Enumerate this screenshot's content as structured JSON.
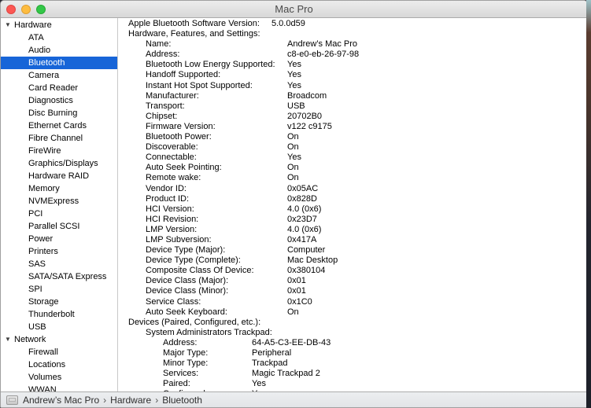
{
  "window": {
    "title": "Mac Pro"
  },
  "accent": {
    "selection_color": "#1765d8",
    "traffic_red": "#fc5753",
    "traffic_yellow": "#fdbc40",
    "traffic_green": "#33c748"
  },
  "sidebar": {
    "items": [
      {
        "type": "group",
        "label": "Hardware"
      },
      {
        "type": "item",
        "label": "ATA"
      },
      {
        "type": "item",
        "label": "Audio"
      },
      {
        "type": "item",
        "label": "Bluetooth",
        "selected": true
      },
      {
        "type": "item",
        "label": "Camera"
      },
      {
        "type": "item",
        "label": "Card Reader"
      },
      {
        "type": "item",
        "label": "Diagnostics"
      },
      {
        "type": "item",
        "label": "Disc Burning"
      },
      {
        "type": "item",
        "label": "Ethernet Cards"
      },
      {
        "type": "item",
        "label": "Fibre Channel"
      },
      {
        "type": "item",
        "label": "FireWire"
      },
      {
        "type": "item",
        "label": "Graphics/Displays"
      },
      {
        "type": "item",
        "label": "Hardware RAID"
      },
      {
        "type": "item",
        "label": "Memory"
      },
      {
        "type": "item",
        "label": "NVMExpress"
      },
      {
        "type": "item",
        "label": "PCI"
      },
      {
        "type": "item",
        "label": "Parallel SCSI"
      },
      {
        "type": "item",
        "label": "Power"
      },
      {
        "type": "item",
        "label": "Printers"
      },
      {
        "type": "item",
        "label": "SAS"
      },
      {
        "type": "item",
        "label": "SATA/SATA Express"
      },
      {
        "type": "item",
        "label": "SPI"
      },
      {
        "type": "item",
        "label": "Storage"
      },
      {
        "type": "item",
        "label": "Thunderbolt"
      },
      {
        "type": "item",
        "label": "USB"
      },
      {
        "type": "group",
        "label": "Network"
      },
      {
        "type": "item",
        "label": "Firewall"
      },
      {
        "type": "item",
        "label": "Locations"
      },
      {
        "type": "item",
        "label": "Volumes"
      },
      {
        "type": "item",
        "label": "WWAN"
      }
    ]
  },
  "content": {
    "rows": [
      {
        "indent": 0,
        "label": "Apple Bluetooth Software Version:",
        "value": "5.0.0d59",
        "col": 182
      },
      {
        "indent": 0,
        "label": "Hardware, Features, and Settings:"
      },
      {
        "indent": 1,
        "label": "Name:",
        "value": "Andrew’s Mac Pro",
        "col": 180
      },
      {
        "indent": 1,
        "label": "Address:",
        "value": "c8-e0-eb-26-97-98",
        "col": 180
      },
      {
        "indent": 1,
        "label": "Bluetooth Low Energy Supported:",
        "value": "Yes",
        "col": 180
      },
      {
        "indent": 1,
        "label": "Handoff Supported:",
        "value": "Yes",
        "col": 180
      },
      {
        "indent": 1,
        "label": "Instant Hot Spot Supported:",
        "value": "Yes",
        "col": 180
      },
      {
        "indent": 1,
        "label": "Manufacturer:",
        "value": "Broadcom",
        "col": 180
      },
      {
        "indent": 1,
        "label": "Transport:",
        "value": "USB",
        "col": 180
      },
      {
        "indent": 1,
        "label": "Chipset:",
        "value": "20702B0",
        "col": 180
      },
      {
        "indent": 1,
        "label": "Firmware Version:",
        "value": "v122 c9175",
        "col": 180
      },
      {
        "indent": 1,
        "label": "Bluetooth Power:",
        "value": "On",
        "col": 180
      },
      {
        "indent": 1,
        "label": "Discoverable:",
        "value": "On",
        "col": 180
      },
      {
        "indent": 1,
        "label": "Connectable:",
        "value": "Yes",
        "col": 180
      },
      {
        "indent": 1,
        "label": "Auto Seek Pointing:",
        "value": "On",
        "col": 180
      },
      {
        "indent": 1,
        "label": "Remote wake:",
        "value": "On",
        "col": 180
      },
      {
        "indent": 1,
        "label": "Vendor ID:",
        "value": "0x05AC",
        "col": 180
      },
      {
        "indent": 1,
        "label": "Product ID:",
        "value": "0x828D",
        "col": 180
      },
      {
        "indent": 1,
        "label": "HCI Version:",
        "value": "4.0 (0x6)",
        "col": 180
      },
      {
        "indent": 1,
        "label": "HCI Revision:",
        "value": "0x23D7",
        "col": 180
      },
      {
        "indent": 1,
        "label": "LMP Version:",
        "value": "4.0 (0x6)",
        "col": 180
      },
      {
        "indent": 1,
        "label": "LMP Subversion:",
        "value": "0x417A",
        "col": 180
      },
      {
        "indent": 1,
        "label": "Device Type (Major):",
        "value": "Computer",
        "col": 180
      },
      {
        "indent": 1,
        "label": "Device Type (Complete):",
        "value": "Mac Desktop",
        "col": 180
      },
      {
        "indent": 1,
        "label": "Composite Class Of Device:",
        "value": "0x380104",
        "col": 180
      },
      {
        "indent": 1,
        "label": "Device Class (Major):",
        "value": "0x01",
        "col": 180
      },
      {
        "indent": 1,
        "label": "Device Class (Minor):",
        "value": "0x01",
        "col": 180
      },
      {
        "indent": 1,
        "label": "Service Class:",
        "value": "0x1C0",
        "col": 180
      },
      {
        "indent": 1,
        "label": "Auto Seek Keyboard:",
        "value": "On",
        "col": 180
      },
      {
        "indent": 0,
        "label": "Devices (Paired, Configured, etc.):"
      },
      {
        "indent": 1,
        "label": "System Administrators Trackpad:"
      },
      {
        "indent": 2,
        "label": "Address:",
        "value": "64-A5-C3-EE-DB-43",
        "col": 113
      },
      {
        "indent": 2,
        "label": "Major Type:",
        "value": "Peripheral",
        "col": 113
      },
      {
        "indent": 2,
        "label": "Minor Type:",
        "value": "Trackpad",
        "col": 113
      },
      {
        "indent": 2,
        "label": "Services:",
        "value": "Magic Trackpad 2",
        "col": 113
      },
      {
        "indent": 2,
        "label": "Paired:",
        "value": "Yes",
        "col": 113
      },
      {
        "indent": 2,
        "label": "Configured:",
        "value": "Yes",
        "col": 113
      }
    ]
  },
  "statusbar": {
    "path": [
      "Andrew’s Mac Pro",
      "Hardware",
      "Bluetooth"
    ],
    "separator": "›"
  }
}
